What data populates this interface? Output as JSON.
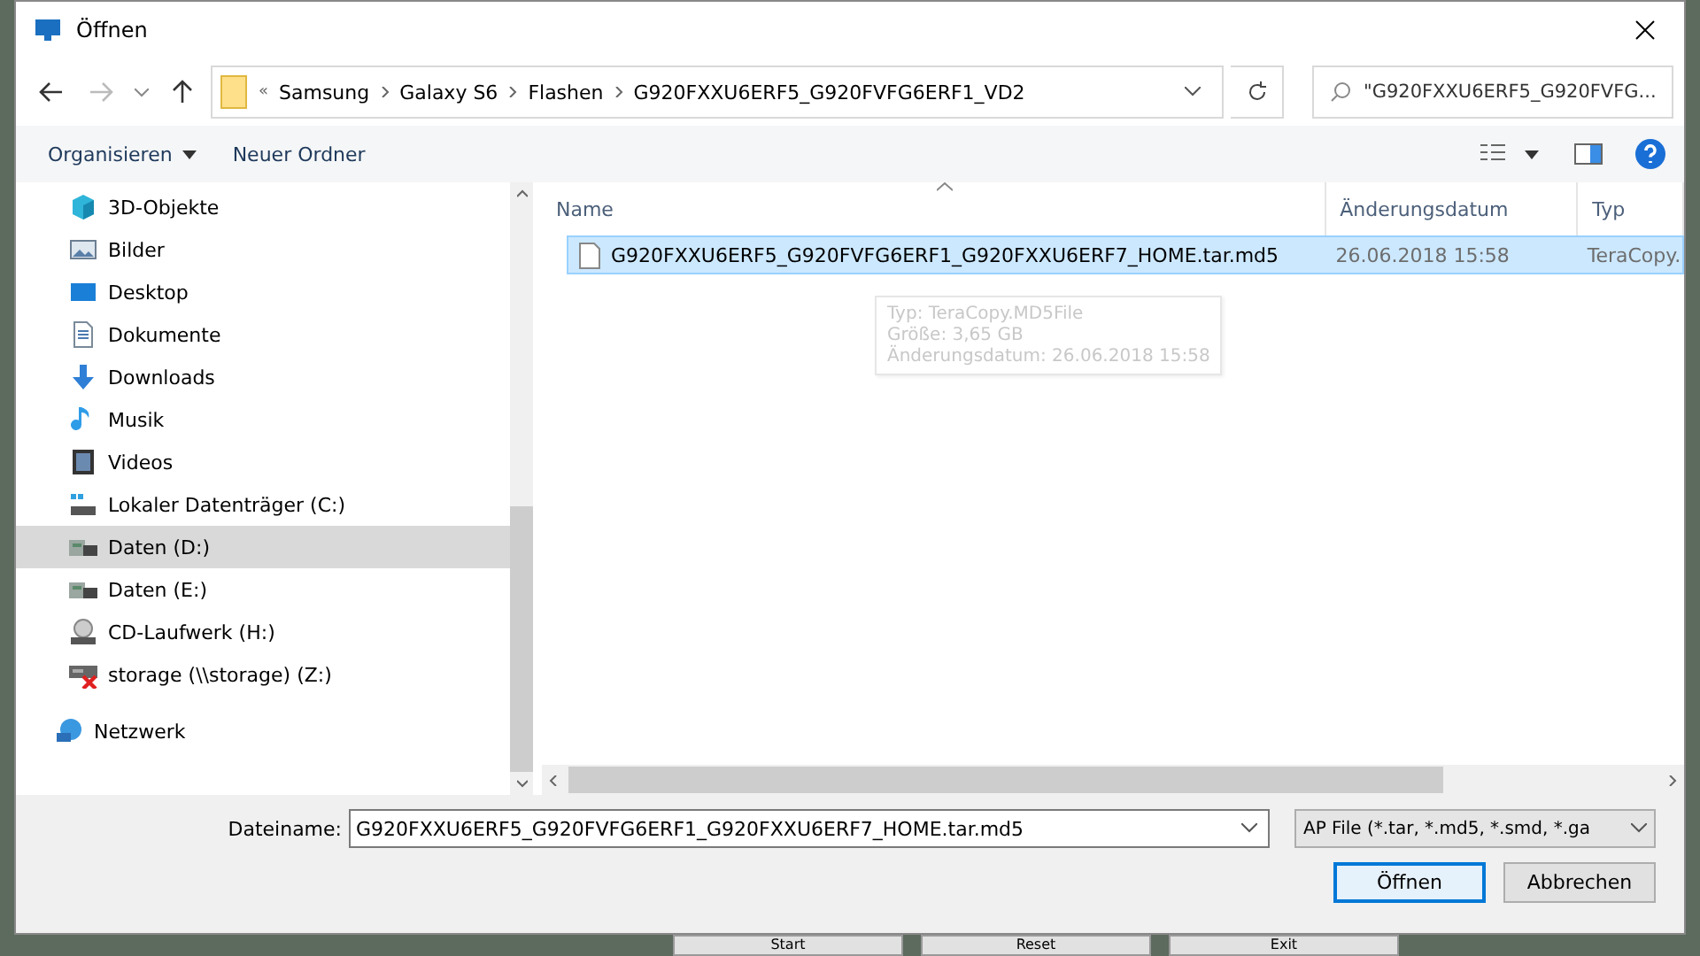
{
  "window": {
    "title": "Öffnen"
  },
  "address_bar": {
    "overflow": "«",
    "breadcrumbs": [
      "Samsung",
      "Galaxy S6",
      "Flashen",
      "G920FXXU6ERF5_G920FVFG6ERF1_VD2"
    ]
  },
  "search": {
    "placeholder": "\"G920FXXU6ERF5_G920FVFG..."
  },
  "toolbar": {
    "organize": "Organisieren",
    "new_folder": "Neuer Ordner"
  },
  "nav": {
    "items": [
      {
        "label": "3D-Objekte",
        "kind": "cube",
        "selected": false
      },
      {
        "label": "Bilder",
        "kind": "pictures",
        "selected": false
      },
      {
        "label": "Desktop",
        "kind": "desktop",
        "selected": false
      },
      {
        "label": "Dokumente",
        "kind": "document",
        "selected": false
      },
      {
        "label": "Downloads",
        "kind": "download",
        "selected": false
      },
      {
        "label": "Musik",
        "kind": "music",
        "selected": false
      },
      {
        "label": "Videos",
        "kind": "video",
        "selected": false
      },
      {
        "label": "Lokaler Datenträger (C:)",
        "kind": "system-drive",
        "selected": false
      },
      {
        "label": "Daten (D:)",
        "kind": "drive",
        "selected": true
      },
      {
        "label": "Daten (E:)",
        "kind": "drive",
        "selected": false
      },
      {
        "label": "CD-Laufwerk (H:)",
        "kind": "cd",
        "selected": false
      },
      {
        "label": "storage (\\\\storage) (Z:)",
        "kind": "network-drive",
        "selected": false
      }
    ],
    "network": {
      "label": "Netzwerk"
    }
  },
  "columns": [
    "Name",
    "Änderungsdatum",
    "Typ"
  ],
  "files": [
    {
      "name": "G920FXXU6ERF5_G920FVFG6ERF1_G920FXXU6ERF7_HOME.tar.md5",
      "modified": "26.06.2018 15:58",
      "type": "TeraCopy.",
      "selected": true
    }
  ],
  "tooltip": [
    "Typ: TeraCopy.MD5File",
    "Größe: 3,65 GB",
    "Änderungsdatum: 26.06.2018 15:58"
  ],
  "filename": {
    "label": "Dateiname:",
    "value": "G920FXXU6ERF5_G920FVFG6ERF1_G920FXXU6ERF7_HOME.tar.md5"
  },
  "filter": {
    "value": "AP File (*.tar, *.md5, *.smd, *.ga"
  },
  "buttons": [
    {
      "label": "Öffnen",
      "kind": "default"
    },
    {
      "label": "Abbrechen",
      "kind": "normal"
    }
  ],
  "background_buttons": [
    "Start",
    "Reset",
    "Exit"
  ]
}
